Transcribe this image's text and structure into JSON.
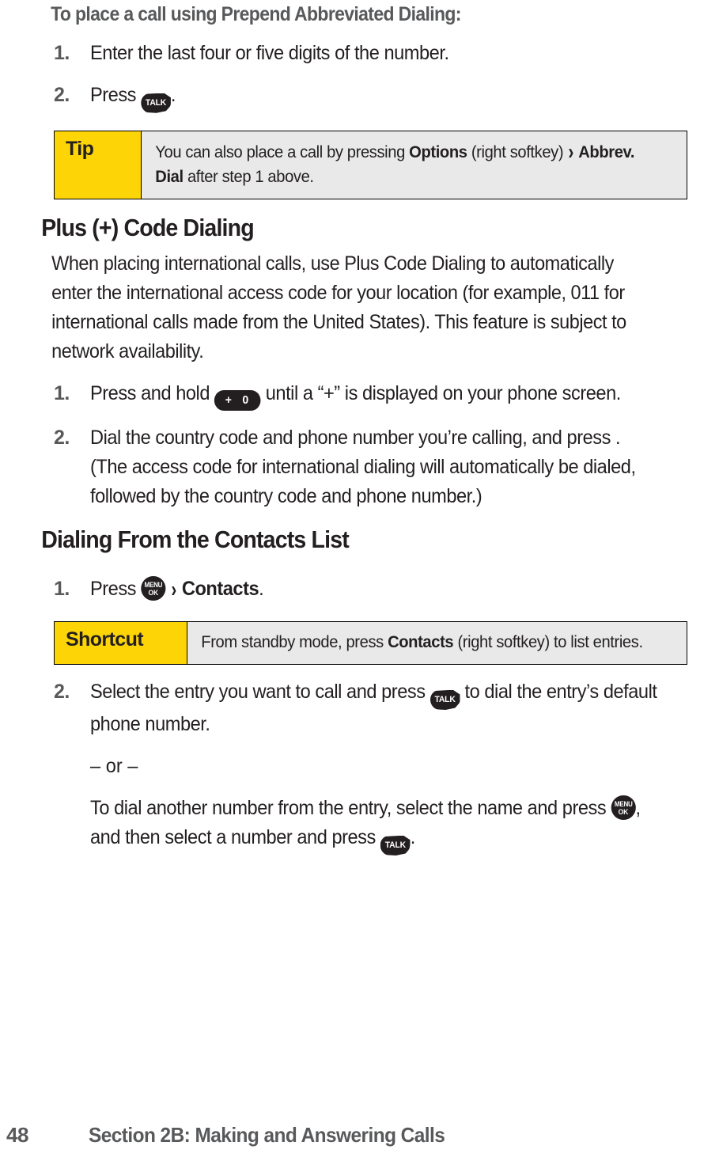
{
  "page": {
    "number": "48",
    "footer_section": "Section 2B: Making and Answering Calls"
  },
  "procedure_heading": "To place a call using Prepend Abbreviated Dialing:",
  "prepend_steps": [
    {
      "num": "1.",
      "text_before": "Enter the last four or five digits of the number.",
      "icon": "",
      "text_after": ""
    },
    {
      "num": "2.",
      "text_before": "Press ",
      "icon": "talk-key",
      "text_after": "."
    }
  ],
  "tip_callout": {
    "label": "Tip",
    "text_1": "You can also place a call by pressing ",
    "bold_1": "Options",
    "text_2": " (right softkey) ",
    "chevron": "›",
    "bold_2": "Abbrev. Dial",
    "text_3": " after step 1 above."
  },
  "plus_code_section": {
    "heading": "Plus (+) Code Dialing",
    "paragraph": "When placing international calls, use Plus Code Dialing to automatically enter the international access code for your location (for example, 011 for international calls made from the United States). This feature is subject to network availability.",
    "steps": [
      {
        "num": "1.",
        "part_1": "Press and hold ",
        "icon": "plus-zero-key",
        "part_2": " until a “+” is displayed on your phone screen."
      },
      {
        "num": "2.",
        "part_1": "Dial the country code and phone number you’re calling, and press ",
        "icon": "",
        "part_2": ". (The access code for international dialing will automatically be dialed, followed by the country code and phone number.)"
      }
    ]
  },
  "contacts_section": {
    "heading": "Dialing From the Contacts List",
    "step_1": {
      "num": "1.",
      "part_1": "Press ",
      "icon": "menu-ok-key",
      "chevron": "›",
      "bold_1": "Contacts",
      "part_2": "."
    },
    "shortcut_callout": {
      "label": "Shortcut",
      "text_1": "From standby mode, press ",
      "bold_1": "Contacts",
      "text_2": " (right softkey) to list entries."
    },
    "step_2": {
      "num": "2.",
      "part_1": "Select the entry you want to call and press ",
      "icon_1": "talk-key",
      "part_2": " to dial the entry’s default phone number.",
      "or_text": "– or –",
      "part_3": "To dial another number from the entry, select the name and press ",
      "icon_2": "menu-ok-key",
      "part_4": ", and then select a number and press ",
      "icon_3": "talk-key",
      "part_5": "."
    }
  },
  "icons": {
    "talk_label": "TALK",
    "menu_label": "MENU",
    "ok_label": "OK",
    "plus_zero_label": "+ 0"
  },
  "colors": {
    "callout_yellow": "#fdd406",
    "callout_gray": "#e9e9e9",
    "heading_gray": "#58595b",
    "body_black": "#231f20"
  }
}
